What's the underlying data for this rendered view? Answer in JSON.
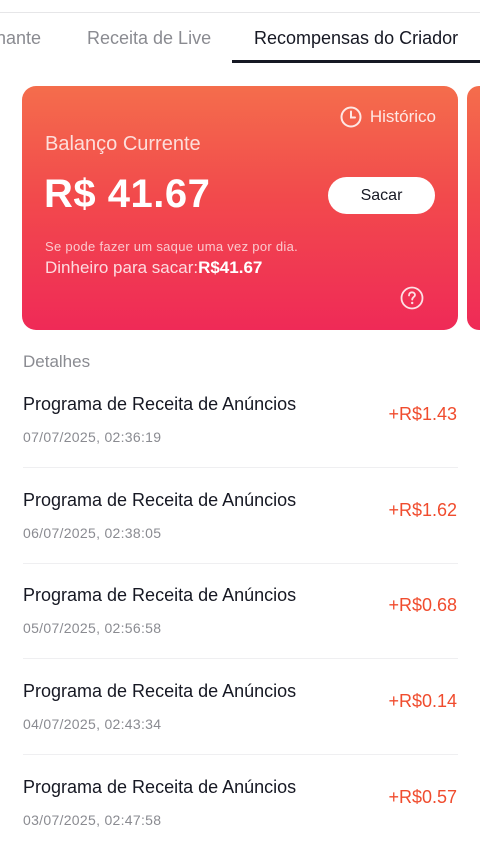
{
  "tabs": [
    {
      "label": "nante"
    },
    {
      "label": "Receita de Live"
    },
    {
      "label": "Recompensas do Criador",
      "active": true
    }
  ],
  "card": {
    "history_label": "Histórico",
    "balance_label": "Balanço Currente",
    "balance_amount": "R$ 41.67",
    "withdraw_button": "Sacar",
    "withdraw_note": "Se pode fazer um saque uma vez por dia.",
    "available_label": "Dinheiro para sacar:",
    "available_value": "R$41.67",
    "accent_colors": [
      "#f46d4c",
      "#ef2a57"
    ]
  },
  "details": {
    "title": "Detalhes",
    "items": [
      {
        "name": "Programa de Receita de Anúncios",
        "time": "07/07/2025, 02:36:19",
        "amount": "+R$1.43"
      },
      {
        "name": "Programa de Receita de Anúncios",
        "time": "06/07/2025, 02:38:05",
        "amount": "+R$1.62"
      },
      {
        "name": "Programa de Receita de Anúncios",
        "time": "05/07/2025, 02:56:58",
        "amount": "+R$0.68"
      },
      {
        "name": "Programa de Receita de Anúncios",
        "time": "04/07/2025, 02:43:34",
        "amount": "+R$0.14"
      },
      {
        "name": "Programa de Receita de Anúncios",
        "time": "03/07/2025, 02:47:58",
        "amount": "+R$0.57"
      }
    ]
  }
}
